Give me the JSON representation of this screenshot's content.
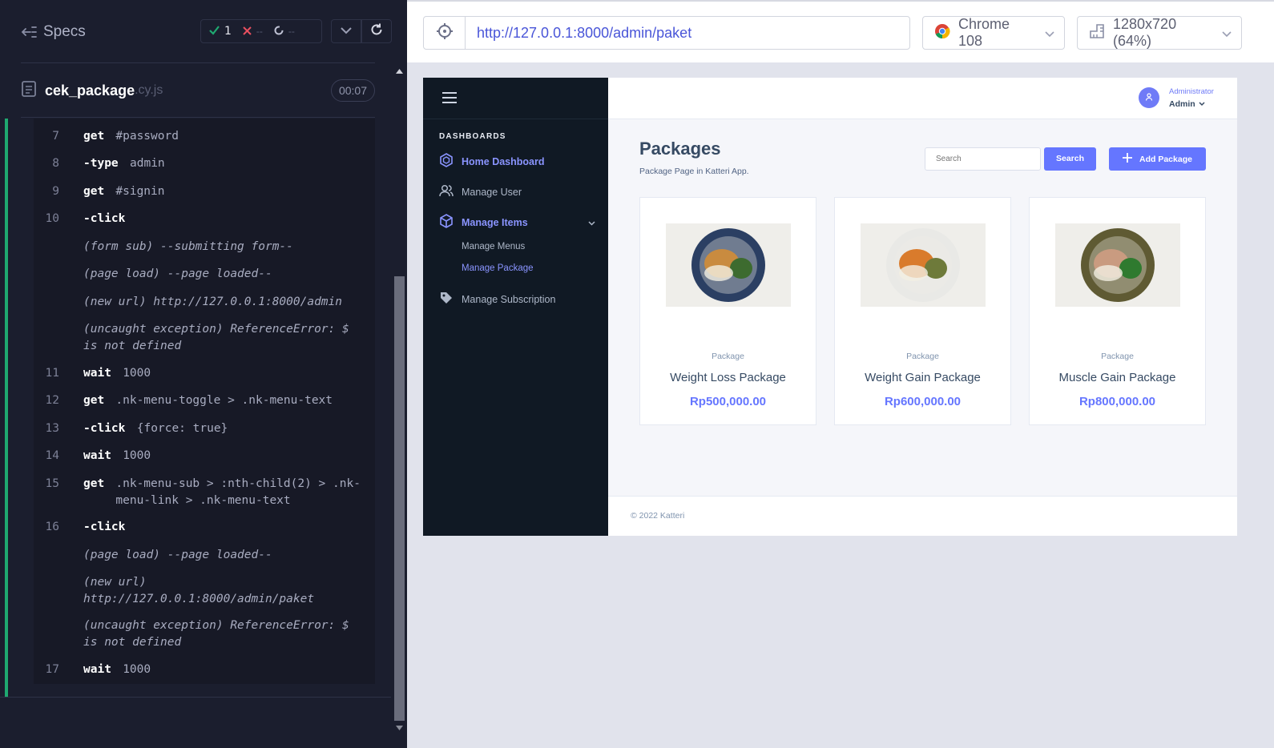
{
  "reporter": {
    "specs_label": "Specs",
    "stats": {
      "passed": "1",
      "failed": "--",
      "pending": "--"
    },
    "spec_file": {
      "name": "cek_package",
      "ext": ".cy.js",
      "duration": "00:07"
    },
    "commands": [
      {
        "line": "7",
        "name": "get",
        "message": "#password"
      },
      {
        "line": "8",
        "name": "-type",
        "message": "admin"
      },
      {
        "line": "9",
        "name": "get",
        "message": "#signin"
      },
      {
        "line": "10",
        "name": "-click",
        "message": ""
      },
      {
        "event": "(form sub)  --submitting form--"
      },
      {
        "event": "(page load)  --page loaded--"
      },
      {
        "event": "(new url)  http://127.0.0.1:8000/admin"
      },
      {
        "event": "(uncaught exception)  ReferenceError: $ is not defined"
      },
      {
        "line": "11",
        "name": "wait",
        "message": "1000"
      },
      {
        "line": "12",
        "name": "get",
        "message": ".nk-menu-toggle > .nk-menu-text"
      },
      {
        "line": "13",
        "name": "-click",
        "message": "{force: true}"
      },
      {
        "line": "14",
        "name": "wait",
        "message": "1000"
      },
      {
        "line": "15",
        "name": "get",
        "message": ".nk-menu-sub > :nth-child(2) > .nk-menu-link > .nk-menu-text"
      },
      {
        "line": "16",
        "name": "-click",
        "message": ""
      },
      {
        "event": "(page load)  --page loaded--"
      },
      {
        "event": "(new url)  http://127.0.0.1:8000/admin/paket"
      },
      {
        "event": "(uncaught exception)  ReferenceError: $ is not defined"
      },
      {
        "line": "17",
        "name": "wait",
        "message": "1000"
      }
    ]
  },
  "aut": {
    "url": "http://127.0.0.1:8000/admin/paket",
    "browser": "Chrome 108",
    "viewport": "1280x720 (64%)"
  },
  "app": {
    "sidebar": {
      "heading": "DASHBOARDS",
      "items": [
        {
          "label": "Home Dashboard",
          "icon": "dashboard-icon"
        },
        {
          "label": "Manage User",
          "icon": "users-icon"
        },
        {
          "label": "Manage Items",
          "icon": "box-icon"
        },
        {
          "label": "Manage Subscription",
          "icon": "tag-icon"
        }
      ],
      "sub_items": [
        "Manage Menus",
        "Manage Package"
      ]
    },
    "user": {
      "role": "Administrator",
      "name": "Admin"
    },
    "page": {
      "title": "Packages",
      "subtitle": "Package Page in Katteri App.",
      "search_placeholder": "Search",
      "search_button": "Search",
      "add_button": "Add Package"
    },
    "packages": [
      {
        "kind": "Package",
        "name": "Weight Loss Package",
        "price": "Rp500,000.00",
        "plate": "#2b3f63",
        "food": "#c98b3f",
        "greens": "#3d6b2f"
      },
      {
        "kind": "Package",
        "name": "Weight Gain Package",
        "price": "Rp600,000.00",
        "plate": "#e9e9e6",
        "food": "#d97b2c",
        "greens": "#6e7a3a"
      },
      {
        "kind": "Package",
        "name": "Muscle Gain Package",
        "price": "Rp800,000.00",
        "plate": "#5f5a33",
        "food": "#c99b80",
        "greens": "#2f7a2f"
      }
    ],
    "footer": "© 2022 Katteri"
  },
  "colors": {
    "accent": "#6576ff",
    "pass": "#1fa971",
    "fail": "#e94f5f",
    "sidebar_bg": "#101924"
  }
}
